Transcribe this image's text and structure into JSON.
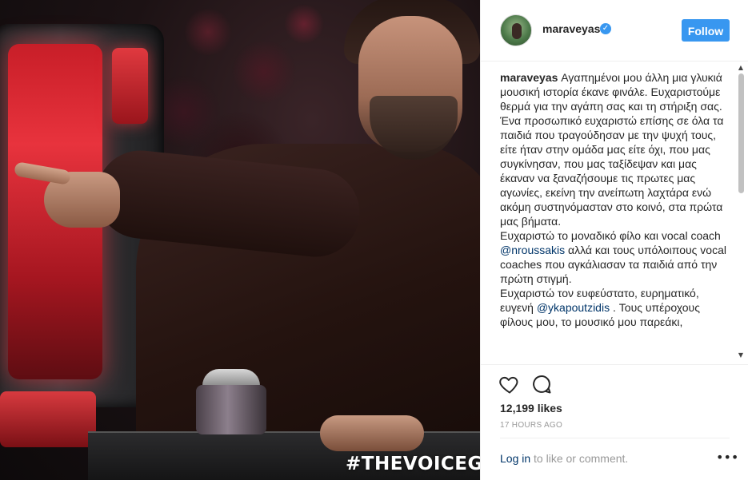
{
  "photo": {
    "alt_description_hidden": "",
    "hashtag": "#THEVOICEGR"
  },
  "header": {
    "username": "maraveyas",
    "verified_icon": "verified-badge-icon",
    "follow_label": "Follow"
  },
  "caption": {
    "username": "maraveyas",
    "paragraph_1": "Αγαπημένοι μου άλλη μια γλυκιά μουσική ιστορία έκανε φινάλε. Ευχαριστούμε θερμά για την αγάπη σας και τη στήριξη σας. Ένα προσωπικό ευχαριστώ επίσης σε όλα τα παιδιά που τραγούδησαν με την ψυχή τους, είτε ήταν στην ομάδα μας είτε όχι, που μας συγκίνησαν, που μας ταξίδεψαν και μας έκαναν να ξαναζήσουμε τις πρωτες μας αγωνίες, εκείνη την ανείπωτη λαχτάρα ενώ ακόμη συστηνόμασταν στο κοινό, στα πρώτα μας βήματα.",
    "paragraph_2_a": "Ευχαριστώ το μοναδικό φίλο και vocal coach ",
    "mention_1": "@nroussakis",
    "paragraph_2_b": " αλλά και τους υπόλοιπους vocal coaches που αγκάλιασαν τα παιδιά από την πρώτη στιγμή.",
    "paragraph_3_a": "Ευχαριστώ τον ευφεύστατο, ευρηματικό, ευγενή ",
    "mention_2": "@ykapoutzidis",
    "paragraph_3_b": " . Τους υπέροχους φίλους μου, το μουσικό μου παρεάκι,"
  },
  "actions": {
    "like_icon": "heart-icon",
    "comment_icon": "comment-icon",
    "likes": "12,199 likes",
    "time": "17 HOURS AGO"
  },
  "footer": {
    "login_link": "Log in",
    "login_rest": " to like or comment.",
    "more_icon": "more-options-icon",
    "more_label": "•••"
  },
  "colors": {
    "accent": "#3897f0",
    "link": "#003569",
    "muted": "#999999",
    "text": "#262626"
  }
}
